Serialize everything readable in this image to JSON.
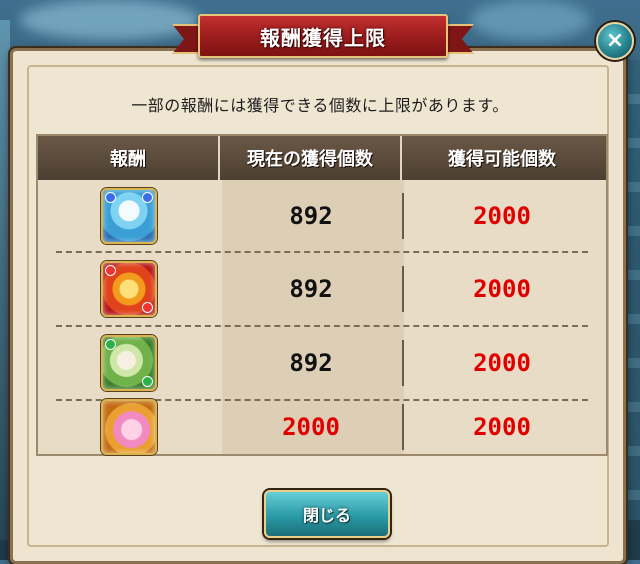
{
  "dialog": {
    "title": "報酬獲得上限",
    "message": "一部の報酬には獲得できる個数に上限があります。",
    "close_label": "閉じる",
    "close_icon_glyph": "×"
  },
  "table": {
    "headers": [
      "報酬",
      "現在の獲得個数",
      "獲得可能個数"
    ],
    "rows": [
      {
        "icon": "blue-water-maiden-icon",
        "current": "892",
        "max": "2000",
        "current_color": "black"
      },
      {
        "icon": "red-sunflower-lion-icon",
        "current": "892",
        "max": "2000",
        "current_color": "black"
      },
      {
        "icon": "green-bamboo-girl-icon",
        "current": "892",
        "max": "2000",
        "current_color": "black"
      },
      {
        "icon": "pink-pufferfish-icon",
        "current": "2000",
        "max": "2000",
        "current_color": "red"
      }
    ]
  },
  "colors": {
    "ribbon": "#9b1c1c",
    "limit_red": "#e10000",
    "button_teal": "#2a9aa6"
  }
}
